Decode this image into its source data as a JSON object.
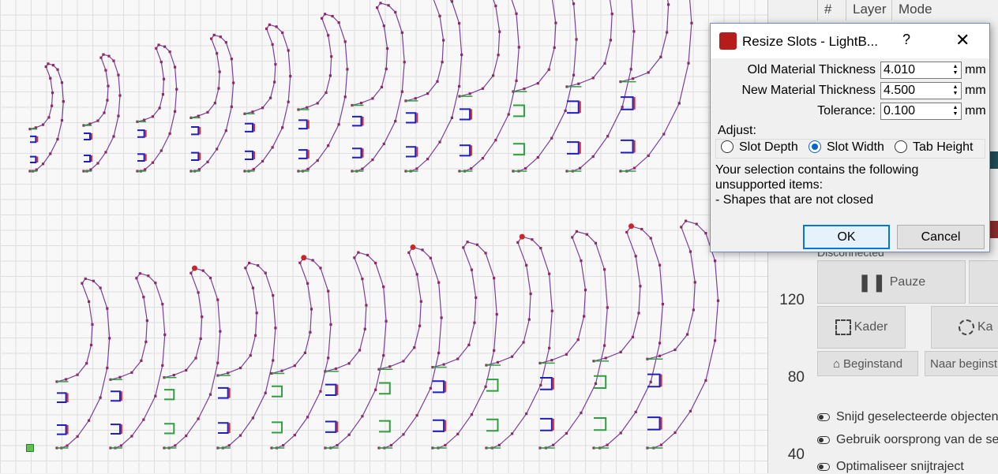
{
  "colors": {
    "shape_stroke": "#7b3f9e",
    "node": "#8a2b63",
    "start_node": "#c62828",
    "tab_blue": "#1f1fbf",
    "tab_green": "#2e9e3e",
    "tab_red": "#d32f2f",
    "accent": "#0078d7"
  },
  "workspace": {
    "ruler_ticks": [
      "120",
      "80",
      "40"
    ]
  },
  "layer_table": {
    "headers": [
      "#",
      "Layer",
      "Mode"
    ]
  },
  "device_panel": {
    "status": "Disconnected",
    "pause_label": "Pauze",
    "frame_label": "Kader",
    "frame2_label": "Ka",
    "home_label": "Beginstand",
    "goto_origin_label": "Naar beginst",
    "options": [
      "Snijd geselecteerde objecten",
      "Gebruik oorsprong van de se",
      "Optimaliseer snijtraject"
    ]
  },
  "dialog": {
    "title": "Resize Slots - LightB...",
    "help": "?",
    "close": "✕",
    "fields": [
      {
        "label": "Old Material Thickness",
        "value": "4.010",
        "unit": "mm"
      },
      {
        "label": "New Material Thickness",
        "value": "4.500",
        "unit": "mm"
      },
      {
        "label": "Tolerance:",
        "value": "0.100",
        "unit": "mm"
      }
    ],
    "adjust_label": "Adjust:",
    "radios": [
      {
        "label": "Slot Depth",
        "selected": false
      },
      {
        "label": "Slot Width",
        "selected": true
      },
      {
        "label": "Tab Height",
        "selected": false
      }
    ],
    "message_lines": [
      "Your selection contains the following",
      "unsupported items:",
      "- Shapes that are not closed"
    ],
    "ok_label": "OK",
    "cancel_label": "Cancel"
  }
}
